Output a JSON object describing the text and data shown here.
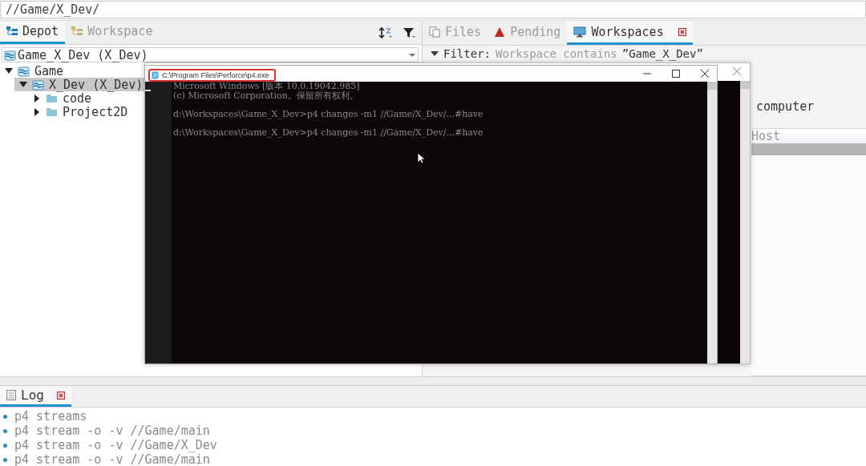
{
  "address_bar": {
    "value": "//Game/X_Dev/"
  },
  "left_panel": {
    "tabs": [
      {
        "label": "Depot",
        "selected": true,
        "kind": "depot"
      },
      {
        "label": "Workspace",
        "selected": false,
        "kind": "workspace"
      }
    ],
    "workspace_dropdown": {
      "value": "Game_X_Dev (X_Dev)"
    },
    "tree": [
      {
        "label": "Game",
        "kind": "depot",
        "expanded": true,
        "selected": false,
        "children": [
          {
            "label": "X_Dev (X_Dev)",
            "kind": "stream",
            "expanded": true,
            "selected": true,
            "children": [
              {
                "label": "code",
                "kind": "folder",
                "expanded": false,
                "selected": false
              },
              {
                "label": "Project2D",
                "kind": "folder",
                "expanded": false,
                "selected": false
              }
            ]
          }
        ]
      }
    ]
  },
  "right_panel": {
    "tabs": [
      {
        "label": "Files",
        "selected": false,
        "kind": "files",
        "closable": false
      },
      {
        "label": "Pending",
        "selected": false,
        "kind": "pending",
        "closable": false
      },
      {
        "label": "Workspaces",
        "selected": true,
        "kind": "workspaces",
        "closable": true
      }
    ],
    "filter": {
      "expanded": true,
      "label": "Filter:",
      "condition": "Workspace contains",
      "value": "”Game_X_Dev”"
    },
    "description": "computer",
    "columns": [
      "Host"
    ]
  },
  "console": {
    "title": "C:\\Program Files\\Perforce\\p4.exe",
    "banner": [
      "Microsoft Windows [版本 10.0.19042.985]",
      "(c) Microsoft Corporation。保留所有权利。"
    ],
    "commands": [
      "d:\\Workspaces\\Game_X_Dev>p4 changes -m1 //Game/X_Dev/...#have",
      "d:\\Workspaces\\Game_X_Dev>p4 changes -m1 //Game/X_Dev/...#have"
    ]
  },
  "log_panel": {
    "tab": {
      "label": "Log",
      "selected": true
    },
    "entries": [
      "p4 streams",
      "p4 stream -o -v //Game/main",
      "p4 stream -o -v //Game/X_Dev",
      "p4 stream -o -v //Game/main"
    ]
  }
}
